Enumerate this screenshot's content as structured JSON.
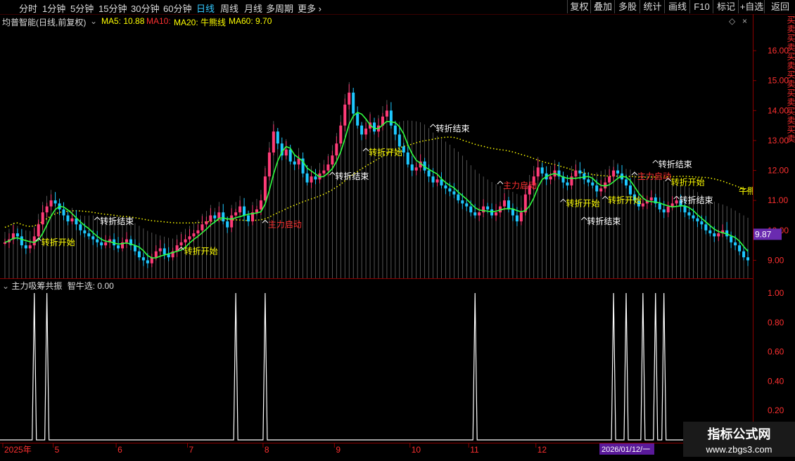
{
  "timeframes": [
    {
      "label": "分时",
      "active": false
    },
    {
      "label": "1分钟",
      "active": false
    },
    {
      "label": "5分钟",
      "active": false
    },
    {
      "label": "15分钟",
      "active": false
    },
    {
      "label": "30分钟",
      "active": false
    },
    {
      "label": "60分钟",
      "active": false
    },
    {
      "label": "日线",
      "active": true
    },
    {
      "label": "周线",
      "active": false
    },
    {
      "label": "月线",
      "active": false
    },
    {
      "label": "多周期",
      "active": false
    },
    {
      "label": "更多",
      "active": false
    }
  ],
  "right_buttons": [
    "复权",
    "叠加",
    "多股",
    "统计",
    "画线",
    "F10",
    "标记",
    "+自选",
    "返回"
  ],
  "info": {
    "stock": "均普智能(日线,前复权)",
    "ma5": "MA5: 10.88",
    "ma10": "MA10: ",
    "ma20": "MA20: 牛熊线",
    "ma60": "MA60: 9.70",
    "colors": {
      "ma5": "#ffff00",
      "ma10": "#ff3030",
      "ma20": "#ffff00",
      "ma60": "#ffff00"
    }
  },
  "price_axis": {
    "ticks": [
      "16.00",
      "15.00",
      "14.00",
      "13.00",
      "12.00",
      "11.00",
      "10.00",
      "9.00"
    ],
    "current": "9.87",
    "min": 8.4,
    "max": 16.8
  },
  "annotations": [
    {
      "text": "转折开始",
      "color": "#ffff00",
      "idx": 8,
      "price": 9.6
    },
    {
      "text": "转折结束",
      "color": "#ffffff",
      "idx": 22,
      "price": 10.3
    },
    {
      "text": "转折开始",
      "color": "#ffff00",
      "idx": 42,
      "price": 9.3
    },
    {
      "text": "主力启动",
      "color": "#ff3030",
      "idx": 62,
      "price": 10.2
    },
    {
      "text": "转折结束",
      "color": "#ffffff",
      "idx": 78,
      "price": 11.8
    },
    {
      "text": "转折开始",
      "color": "#ffff00",
      "idx": 86,
      "price": 12.6
    },
    {
      "text": "转折结束",
      "color": "#ffffff",
      "idx": 102,
      "price": 13.4
    },
    {
      "text": "主力启动",
      "color": "#ff3030",
      "idx": 118,
      "price": 11.5
    },
    {
      "text": "转折开始",
      "color": "#ffff00",
      "idx": 133,
      "price": 10.9
    },
    {
      "text": "转折结束",
      "color": "#ffffff",
      "idx": 138,
      "price": 10.3
    },
    {
      "text": "转折开始",
      "color": "#ffff00",
      "idx": 143,
      "price": 11.0
    },
    {
      "text": "主力启动",
      "color": "#ff3030",
      "idx": 150,
      "price": 11.8
    },
    {
      "text": "转折结束",
      "color": "#ffffff",
      "idx": 155,
      "price": 12.2
    },
    {
      "text": "转折开始",
      "color": "#ffff00",
      "idx": 158,
      "price": 11.6
    },
    {
      "text": "转折结束",
      "color": "#ffffff",
      "idx": 160,
      "price": 11.0
    }
  ],
  "ma60_label": "牛熊",
  "sub_panel": {
    "title": "主力吸筹共振",
    "value": "智牛选: 0.00",
    "ticks": [
      "1.00",
      "0.80",
      "0.60",
      "0.40",
      "0.20"
    ],
    "pulses": [
      7,
      10,
      55,
      62,
      112,
      145,
      148,
      152,
      155,
      157
    ]
  },
  "right_strip": "买卖买卖买卖买卖买卖买卖买卖",
  "date_axis": {
    "labels": [
      {
        "text": "2025年",
        "idx": 0
      },
      {
        "text": "5",
        "idx": 12
      },
      {
        "text": "6",
        "idx": 27
      },
      {
        "text": "7",
        "idx": 44
      },
      {
        "text": "8",
        "idx": 62
      },
      {
        "text": "9",
        "idx": 79
      },
      {
        "text": "10",
        "idx": 97
      },
      {
        "text": "11",
        "idx": 111
      },
      {
        "text": "12",
        "idx": 127
      },
      {
        "text": "1",
        "idx": 145
      }
    ],
    "cursor_date": "2026/01/12/一"
  },
  "watermark": {
    "line1": "指标公式网",
    "line2": "www.zbgs3.com"
  },
  "chart_data": {
    "type": "candlestick",
    "close": [
      9.6,
      9.7,
      9.9,
      9.8,
      9.5,
      9.4,
      9.5,
      9.8,
      10.2,
      10.6,
      10.8,
      11.0,
      10.9,
      10.7,
      10.5,
      10.3,
      10.4,
      10.2,
      10.0,
      9.9,
      9.8,
      9.7,
      9.6,
      9.5,
      9.6,
      9.7,
      9.5,
      9.4,
      9.6,
      9.7,
      9.5,
      9.3,
      9.1,
      9.0,
      8.9,
      9.1,
      9.3,
      9.4,
      9.2,
      9.1,
      9.3,
      9.5,
      9.6,
      9.7,
      9.8,
      9.9,
      10.0,
      10.2,
      10.3,
      10.5,
      10.4,
      10.6,
      10.3,
      10.1,
      10.5,
      10.6,
      10.8,
      10.5,
      10.3,
      10.6,
      10.7,
      11.0,
      11.8,
      12.6,
      13.3,
      12.9,
      12.5,
      12.7,
      12.3,
      12.2,
      12.4,
      11.9,
      11.6,
      11.8,
      11.7,
      11.9,
      12.0,
      12.2,
      12.5,
      12.9,
      13.5,
      14.2,
      14.6,
      13.9,
      13.5,
      13.2,
      13.4,
      13.6,
      13.3,
      13.5,
      13.8,
      14.0,
      13.5,
      13.2,
      12.8,
      12.6,
      12.2,
      12.0,
      12.1,
      12.3,
      12.0,
      11.8,
      11.6,
      11.7,
      11.5,
      11.4,
      11.3,
      11.2,
      11.0,
      10.9,
      10.8,
      10.6,
      10.5,
      10.6,
      10.8,
      10.7,
      10.5,
      10.6,
      10.8,
      11.0,
      10.7,
      10.5,
      10.3,
      10.6,
      11.2,
      11.5,
      11.8,
      12.1,
      11.9,
      11.7,
      11.8,
      12.0,
      11.8,
      11.6,
      11.5,
      11.8,
      12.0,
      11.9,
      11.7,
      11.6,
      11.5,
      11.3,
      11.4,
      11.6,
      11.8,
      12.0,
      11.9,
      11.7,
      11.5,
      11.2,
      11.0,
      10.8,
      10.9,
      11.0,
      11.1,
      10.9,
      10.7,
      10.6,
      10.8,
      10.9,
      11.0,
      10.8,
      10.6,
      10.5,
      10.4,
      10.3,
      10.2,
      10.0,
      9.9,
      9.8,
      9.9,
      10.0,
      9.8,
      9.6,
      9.5,
      9.3,
      9.1,
      9.0
    ]
  }
}
